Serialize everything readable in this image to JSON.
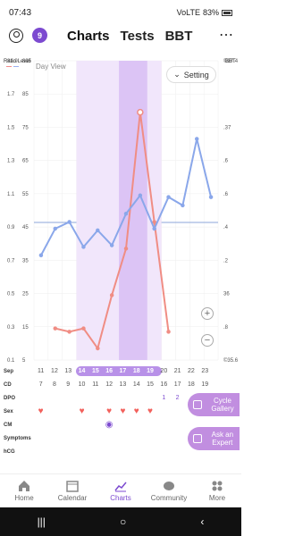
{
  "status": {
    "time": "07:43",
    "battery": "83%",
    "net": "VoLTE"
  },
  "header": {
    "badge": "9",
    "tabs": [
      {
        "label": "Charts"
      },
      {
        "label": "Tests"
      },
      {
        "label": "BBT"
      }
    ],
    "menu": "⋯"
  },
  "chart": {
    "left_axis_title": "Ratio Level",
    "right_axis_title": "BBT",
    "day_view": "Day View",
    "setting": "Setting",
    "left_ticks_outer": [
      "81.9",
      "1.7",
      "1.5",
      "1.3",
      "1.1",
      "0.9",
      "0.7",
      "0.5",
      "0.3",
      "0.1"
    ],
    "left_ticks_inner": [
      "895",
      "85",
      "75",
      "65",
      "55",
      "45",
      "35",
      "25",
      "15",
      "5"
    ],
    "right_ticks": [
      "©37.4",
      "",
      ".37",
      ".6",
      ".6",
      ".4",
      ".2",
      "36",
      ".8",
      "©35.6"
    ],
    "zoom_in": "+",
    "zoom_out": "−"
  },
  "chart_data": {
    "type": "line",
    "x": [
      11,
      12,
      13,
      14,
      15,
      16,
      17,
      18,
      19,
      20,
      21,
      22,
      23
    ],
    "series": [
      {
        "values": [
          null,
          14.5,
          13.5,
          14.5,
          8.5,
          24.5,
          38.5,
          79.5,
          46.5,
          13.5,
          null,
          null,
          null
        ]
      },
      {
        "values": [
          0.73,
          0.89,
          0.93,
          0.78,
          0.88,
          0.79,
          0.98,
          1.09,
          0.89,
          1.08,
          1.03,
          1.43,
          1.08
        ]
      }
    ]
  },
  "rows": {
    "sep_label": "Sep",
    "sep": [
      "11",
      "12",
      "13",
      "14",
      "15",
      "16",
      "17",
      "18",
      "19",
      "20",
      "21",
      "22",
      "23"
    ],
    "cd_label": "CD",
    "cd": [
      "7",
      "8",
      "9",
      "10",
      "11",
      "12",
      "13",
      "14",
      "15",
      "16",
      "17",
      "18",
      "19"
    ],
    "dpo_label": "DPO",
    "dpo": [
      "",
      "",
      "",
      "",
      "",
      "",
      "",
      "",
      "",
      "1",
      "2",
      "",
      ""
    ],
    "sex_label": "Sex",
    "cm_label": "CM",
    "symptoms_label": "Symptoms",
    "hcg_label": "hCG"
  },
  "float": {
    "cycle_gallery": "Cycle Gallery",
    "ask_expert": "Ask an Expert"
  },
  "nav": [
    {
      "label": "Home"
    },
    {
      "label": "Calendar"
    },
    {
      "label": "Charts"
    },
    {
      "label": "Community"
    },
    {
      "label": "More"
    }
  ]
}
